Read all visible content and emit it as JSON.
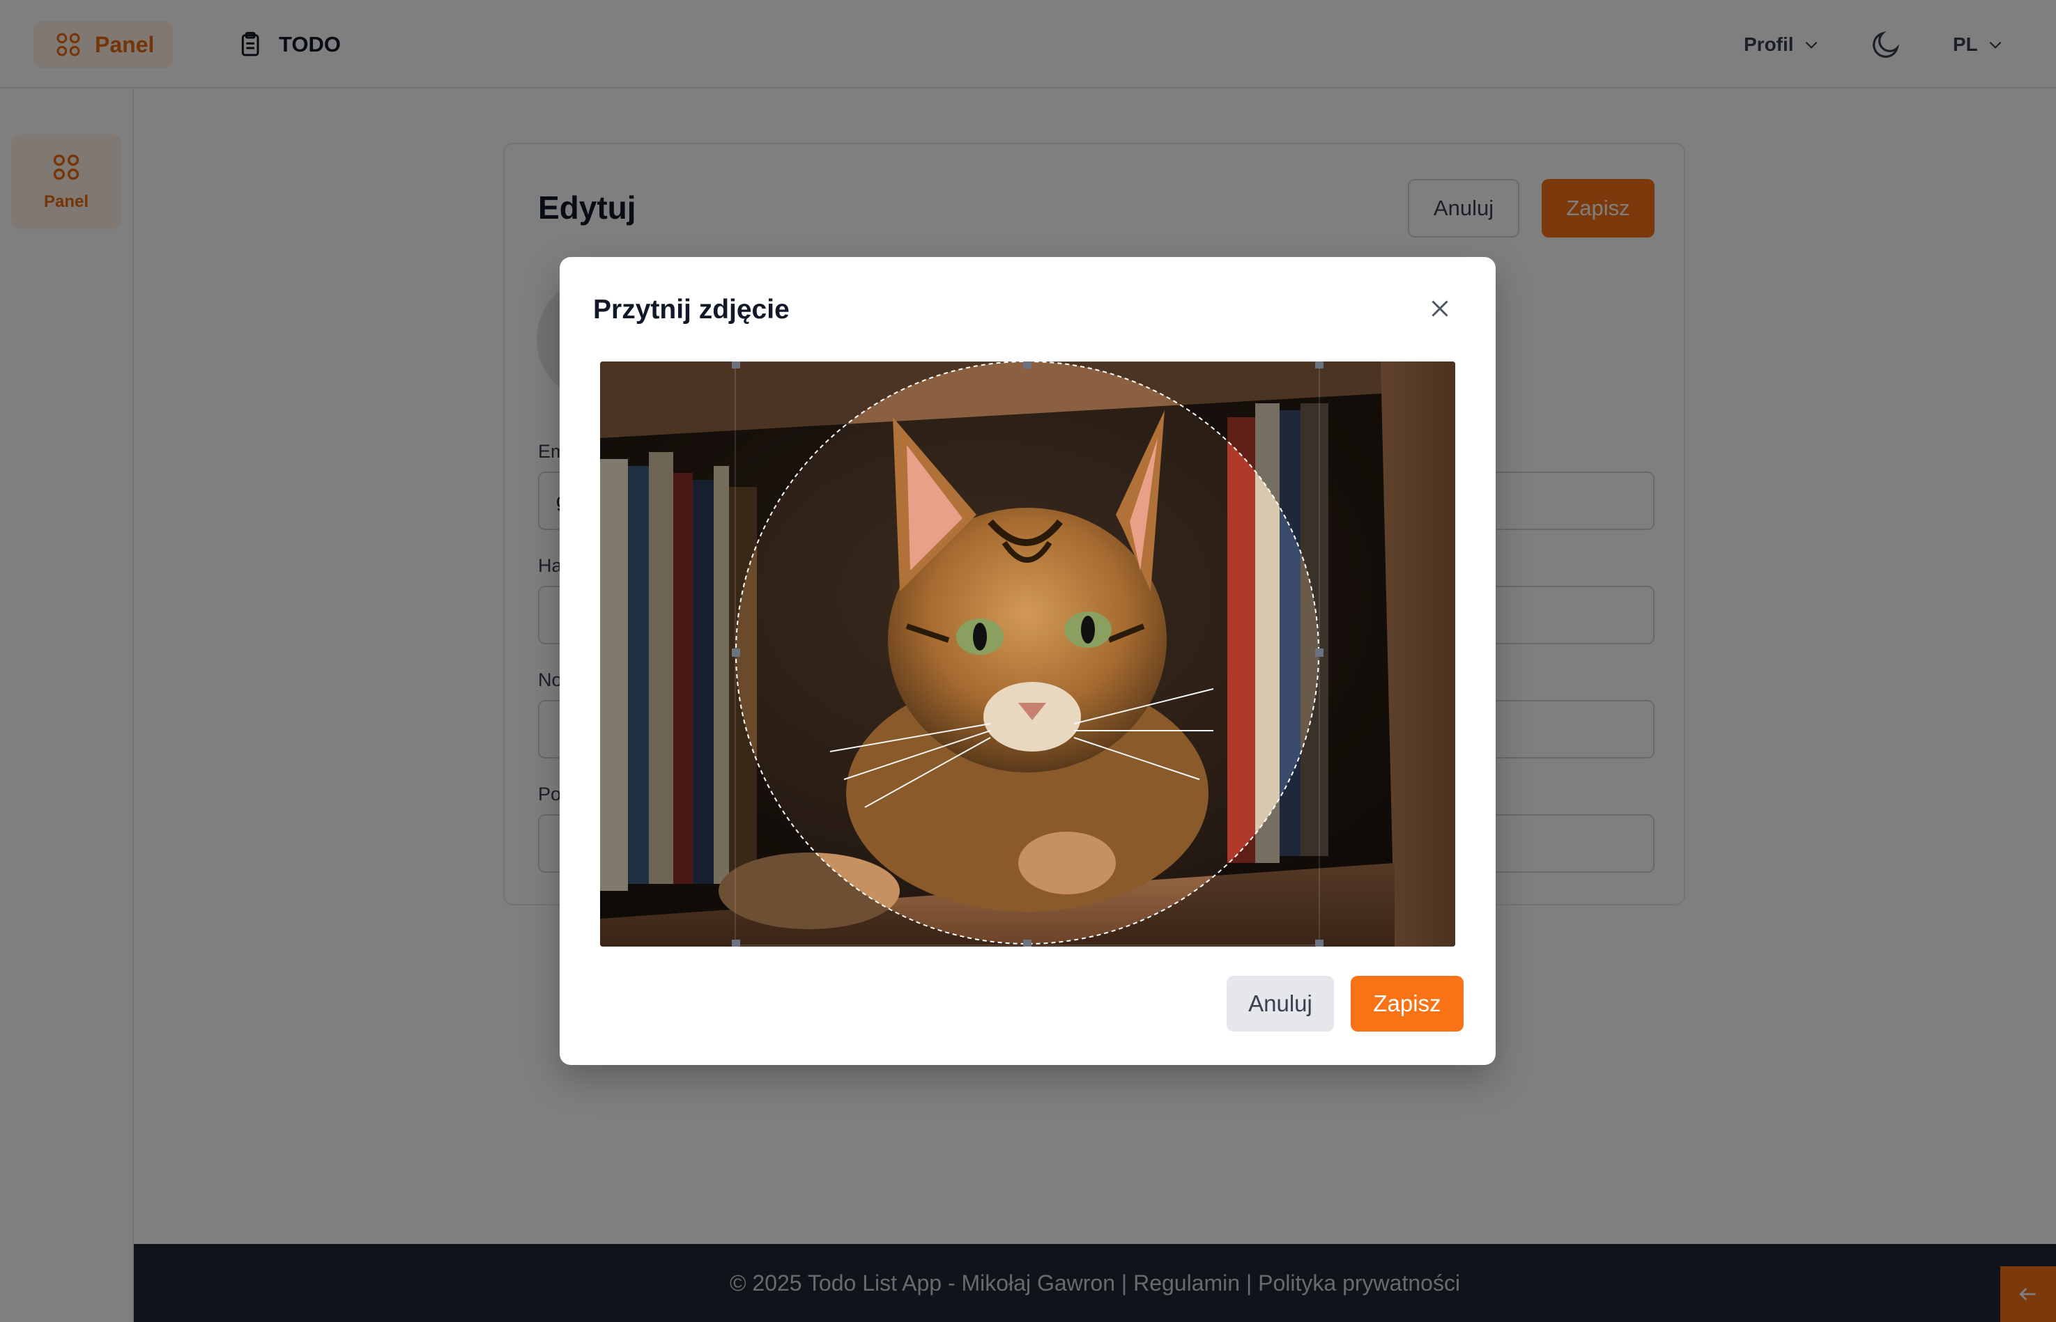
{
  "header": {
    "brand_label": "Panel",
    "todo_label": "TODO",
    "profile_label": "Profil",
    "language_label": "PL"
  },
  "sidebar": {
    "items": [
      {
        "label": "Panel",
        "icon": "grid-icon"
      }
    ]
  },
  "edit_card": {
    "title": "Edytuj",
    "cancel_label": "Anuluj",
    "save_label": "Zapisz",
    "fields": [
      {
        "label": "Em",
        "value": "g"
      },
      {
        "label": "Ha",
        "value": ""
      },
      {
        "label": "No",
        "value": ""
      },
      {
        "label": "Po",
        "value": ""
      }
    ]
  },
  "crop_modal": {
    "title": "Przytnij zdjęcie",
    "cancel_label": "Anuluj",
    "save_label": "Zapisz",
    "image_subject": "tabby cat on bookshelf",
    "crop_shape": "circle"
  },
  "footer": {
    "text": "© 2025 Todo List App - Mikołaj Gawron | Regulamin | Polityka prywatności"
  },
  "colors": {
    "accent": "#f97316",
    "accent_text": "#ea6a0c",
    "footer_bg": "#1f2937",
    "overlay": "rgba(0,0,0,0.5)"
  }
}
